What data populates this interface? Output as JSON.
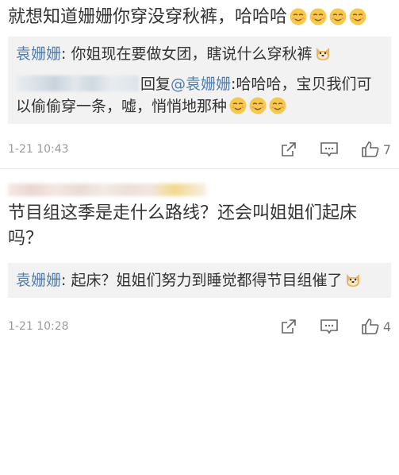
{
  "comments": [
    {
      "text": "就想知道姗姗你穿没穿秋裤，哈哈哈",
      "text_emojis": [
        "smirk-emoji",
        "smirk-emoji",
        "smirk-emoji",
        "smirk-emoji"
      ],
      "replies": [
        {
          "user": "袁姗姗",
          "sep": ": ",
          "text": "你姐现在要做女团，瞎说什么穿秋裤",
          "emojis": [
            "doge-emoji"
          ]
        },
        {
          "reply_prefix": "回复",
          "mention": "@袁姗姗",
          "sep": ":",
          "text": "哈哈哈，宝贝我们可以偷偷穿一条，嘘，悄悄地那种",
          "emojis": [
            "smirk-emoji",
            "smirk-emoji",
            "smirk-emoji"
          ]
        }
      ],
      "time": "1-21 10:43",
      "likes": "7"
    },
    {
      "text": "节目组这季是走什么路线？还会叫姐姐们起床吗？",
      "replies": [
        {
          "user": "袁姗姗",
          "sep": ": ",
          "text": "起床？姐姐们努力到睡觉都得节目组催了",
          "emojis": [
            "doge-emoji"
          ]
        }
      ],
      "time": "1-21 10:28",
      "likes": "4"
    }
  ],
  "colors": {
    "link": "#507daf",
    "reply_bg": "#f2f2f2",
    "meta": "#9a9a9a",
    "emoji_face": "#f7c84a"
  },
  "icons": {
    "repost": "repost-icon",
    "comment": "comment-icon",
    "like": "like-icon"
  }
}
